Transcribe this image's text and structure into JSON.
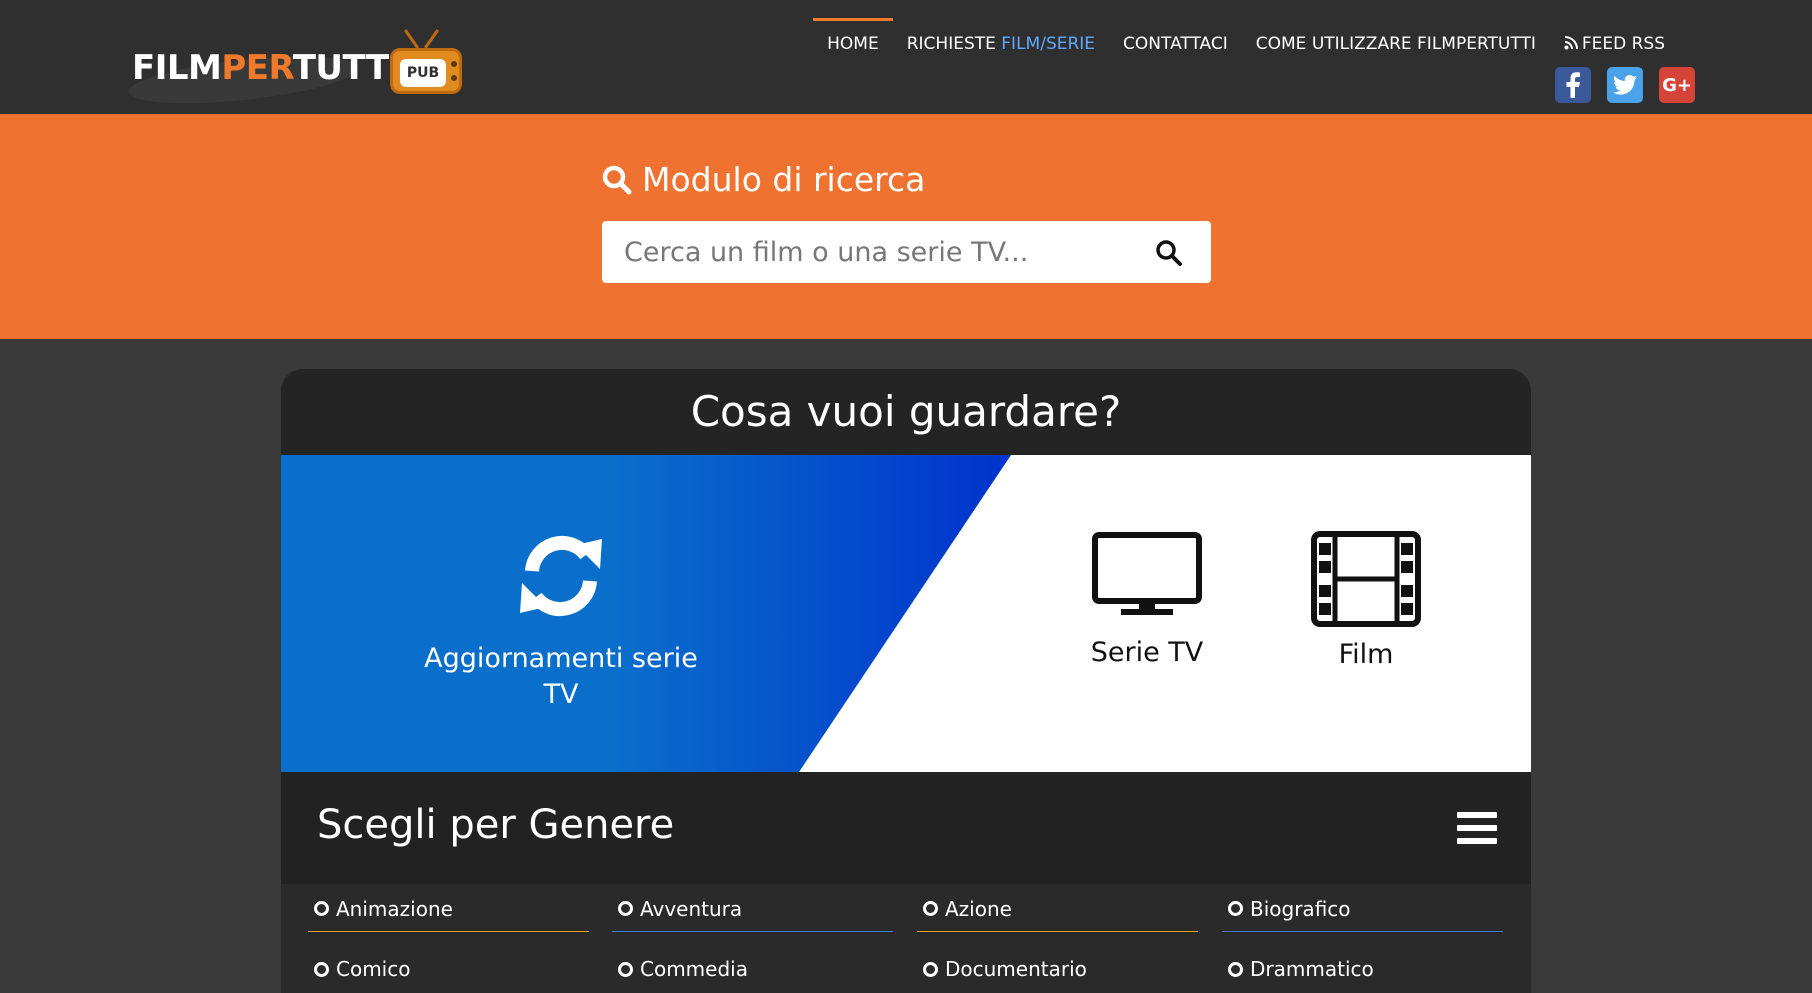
{
  "header": {
    "logo": {
      "part1": "FILM",
      "part2": "PER",
      "part3": "TUTTI",
      "badge": "PUB"
    },
    "nav": [
      {
        "label": "HOME",
        "active": true
      },
      {
        "label_a": "RICHIESTE ",
        "label_b": "FILM/SERIE"
      },
      {
        "label": "CONTATTACI"
      },
      {
        "label": "COME UTILIZZARE FILMPERTUTTI"
      },
      {
        "label": "FEED RSS",
        "icon": "rss-icon"
      }
    ],
    "social": [
      {
        "name": "facebook-icon",
        "glyph": "f"
      },
      {
        "name": "twitter-icon",
        "glyph": "t"
      },
      {
        "name": "google-plus-icon",
        "glyph": "G+"
      }
    ]
  },
  "search": {
    "title": "Modulo di ricerca",
    "placeholder": "Cerca un film o una serie TV..."
  },
  "main": {
    "heading": "Cosa vuoi guardare?",
    "options": [
      {
        "label": "Aggiornamenti serie TV",
        "icon": "refresh-icon"
      },
      {
        "label": "Serie TV",
        "icon": "tv-icon"
      },
      {
        "label": "Film",
        "icon": "film-icon"
      }
    ],
    "genre_title": "Scegli per Genere",
    "genres": [
      "Animazione",
      "Avventura",
      "Azione",
      "Biografico",
      "Comico",
      "Commedia",
      "Documentario",
      "Drammatico"
    ]
  },
  "colors": {
    "accent": "#f07230",
    "link": "#5fa8ff",
    "blue": "#0a6fcb"
  }
}
